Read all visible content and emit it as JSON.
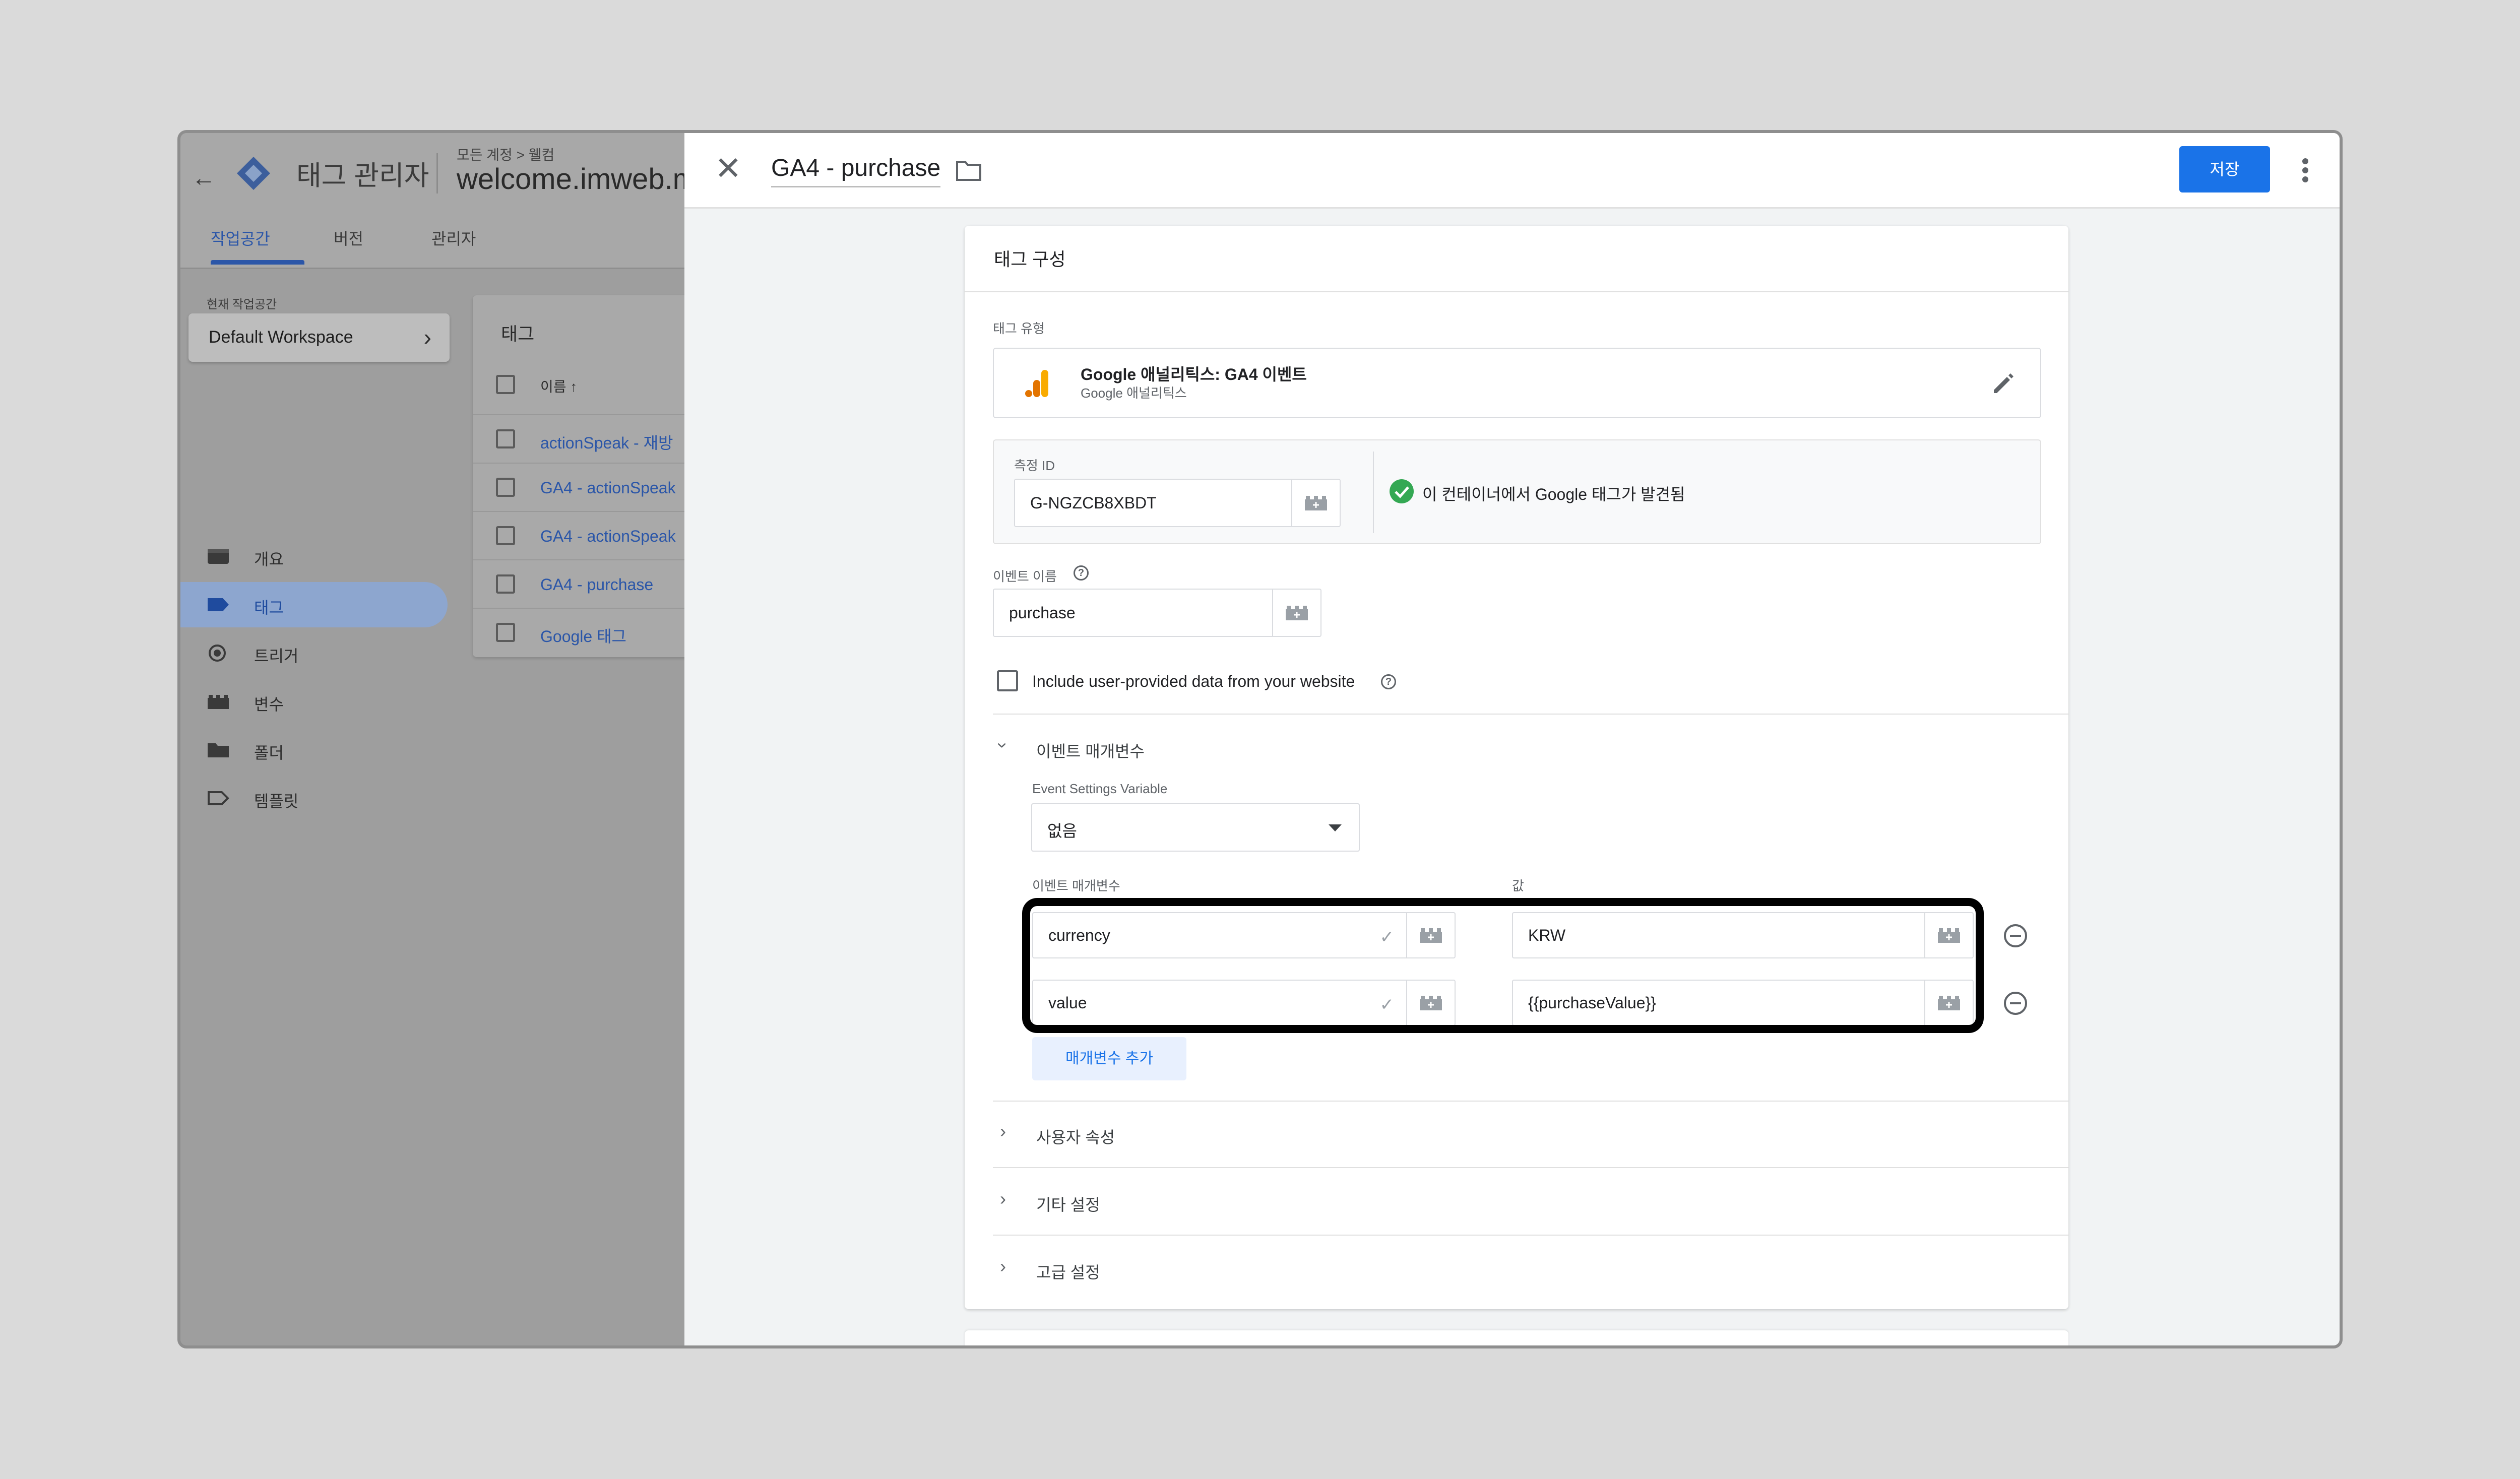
{
  "app": {
    "title": "태그 관리자",
    "breadcrumb": "모든 계정 > 웰컴",
    "container_name": "welcome.imweb.me",
    "tabs": [
      "작업공간",
      "버전",
      "관리자"
    ],
    "workspace_label": "현재 작업공간",
    "workspace_name": "Default Workspace",
    "sidebar": [
      {
        "label": "개요",
        "icon": "overview-icon"
      },
      {
        "label": "태그",
        "icon": "tag-icon"
      },
      {
        "label": "트리거",
        "icon": "trigger-icon"
      },
      {
        "label": "변수",
        "icon": "variable-icon"
      },
      {
        "label": "폴더",
        "icon": "folder-icon"
      },
      {
        "label": "템플릿",
        "icon": "template-icon"
      }
    ],
    "tags_card": {
      "title": "태그",
      "column_name": "이름 ↑",
      "rows": [
        "actionSpeak - 재방",
        "GA4 - actionSpeak",
        "GA4 - actionSpeak",
        "GA4 - purchase",
        "Google 태그"
      ]
    }
  },
  "panel": {
    "title": "GA4 - purchase",
    "save_label": "저장",
    "card_title": "태그 구성",
    "tag_type_label": "태그 유형",
    "tag_type_name": "Google 애널리틱스: GA4 이벤트",
    "tag_type_sub": "Google 애널리틱스",
    "measurement_id_label": "측정 ID",
    "measurement_id": "G-NGZCB8XBDT",
    "found_message": "이 컨테이너에서 Google 태그가 발견됨",
    "event_name_label": "이벤트 이름",
    "event_name": "purchase",
    "include_user_data_label": "Include user-provided data from your website",
    "event_params_section": "이벤트 매개변수",
    "event_settings_label": "Event Settings Variable",
    "event_settings_value": "없음",
    "param_col_label": "이벤트 매개변수",
    "value_col_label": "값",
    "params": [
      {
        "name": "currency",
        "value": "KRW"
      },
      {
        "name": "value",
        "value": "{{purchaseValue}}"
      }
    ],
    "add_param_label": "매개변수 추가",
    "sections": [
      "사용자 속성",
      "기타 설정",
      "고급 설정"
    ]
  },
  "colors": {
    "accent": "#1a73e8",
    "success": "#34a853",
    "ga_orange": "#f9ab00",
    "ga_dark": "#e37400"
  }
}
